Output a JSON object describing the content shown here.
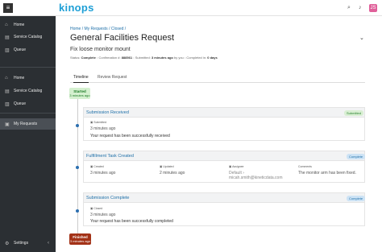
{
  "app": {
    "logo": "kinops",
    "menu_glyph": "≡",
    "search_glyph": "⌕",
    "bell_glyph": "♪",
    "avatar_initials": "JS",
    "brand_color": "#1d9fd6"
  },
  "sidebar": {
    "group1": [
      {
        "label": "Home",
        "icon": "home-icon",
        "glyph": "⌂"
      },
      {
        "label": "Service Catalog",
        "icon": "catalog-icon",
        "glyph": "▤"
      },
      {
        "label": "Queue",
        "icon": "queue-icon",
        "glyph": "▥"
      }
    ],
    "group2": [
      {
        "label": "Home",
        "icon": "home-icon",
        "glyph": "⌂"
      },
      {
        "label": "Service Catalog",
        "icon": "catalog-icon",
        "glyph": "▤"
      },
      {
        "label": "Queue",
        "icon": "queue-icon",
        "glyph": "▥"
      }
    ],
    "active": {
      "label": "My Requests",
      "icon": "requests-icon",
      "glyph": "▣"
    },
    "settings": {
      "label": "Settings",
      "icon": "gear-icon",
      "glyph": "⚙"
    },
    "collapse_glyph": "‹"
  },
  "breadcrumb": "Home / My Requests / Closed /",
  "page": {
    "title": "General Facilities Request",
    "expand_glyph": "⌄",
    "subtitle": "Fix loose monitor mount"
  },
  "meta": {
    "status_label": "Status:",
    "status_value": "Complete",
    "confirmation_label": "Confirmation #:",
    "confirmation_value": "888561",
    "submitted_label": "Submitted:",
    "submitted_value": "3 minutes ago",
    "submitted_by": "by you",
    "completed_label": "Completed in:",
    "completed_value": "0 days"
  },
  "tabs": [
    "Timeline",
    "Review Request"
  ],
  "timeline": {
    "started_label": "Started",
    "started_time": "3 minutes ago",
    "finished_label": "Finished",
    "finished_time": "3 minutes ago",
    "cards": [
      {
        "title": "Submission Received",
        "status": "Submitted",
        "field_label": "Submitted",
        "field_value": "3 minutes ago",
        "message": "Your request has been successfully received"
      },
      {
        "title": "Fulfillment Task Created",
        "status": "Complete",
        "created_label": "Created",
        "created_value": "3 minutes ago",
        "updated_label": "Updated",
        "updated_value": "2 minutes ago",
        "assignee_label": "Assignee",
        "assignee_value_1": "Default ›",
        "assignee_value_2": "micah.smith@kineticdata.com",
        "comments_label": "Comments",
        "comments_value": "The monitor arm has been fixed."
      },
      {
        "title": "Submission Complete",
        "status": "Complete",
        "field_label": "Closed",
        "field_value": "3 minutes ago",
        "message": "Your request has been successfully completed"
      }
    ]
  }
}
